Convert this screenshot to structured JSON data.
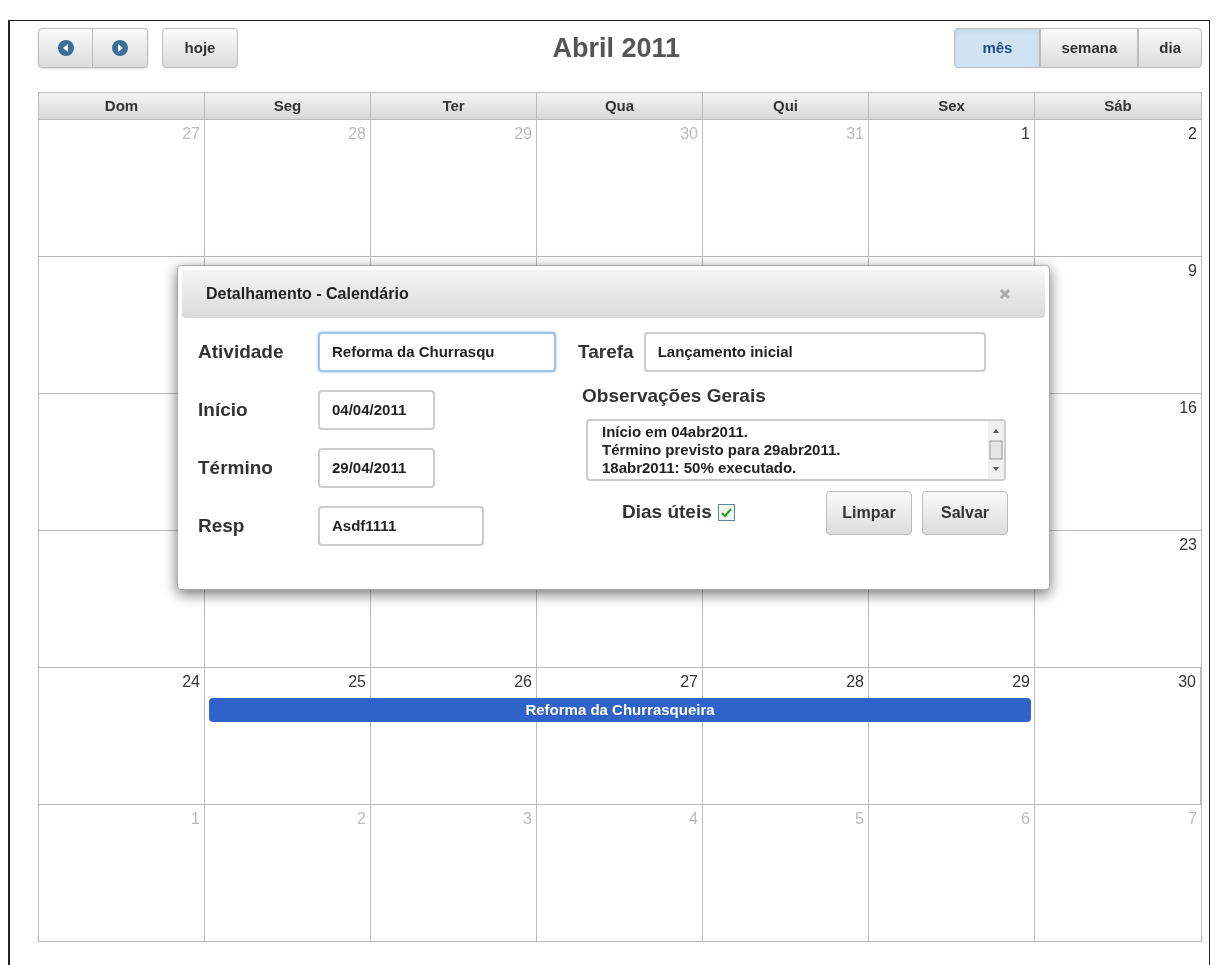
{
  "toolbar": {
    "today": "hoje",
    "title": "Abril 2011",
    "views": [
      {
        "label": "mês",
        "selected": true
      },
      {
        "label": "semana",
        "selected": false
      },
      {
        "label": "dia",
        "selected": false
      }
    ]
  },
  "weekdays": [
    "Dom",
    "Seg",
    "Ter",
    "Qua",
    "Qui",
    "Sex",
    "Sáb"
  ],
  "weeks": [
    {
      "kind": "full",
      "days": [
        {
          "label": "27",
          "other_month": true
        },
        {
          "label": "28",
          "other_month": true
        },
        {
          "label": "29",
          "other_month": true
        },
        {
          "label": "30",
          "other_month": true
        },
        {
          "label": "31",
          "other_month": true
        },
        {
          "label": "1",
          "other_month": false
        },
        {
          "label": "2",
          "other_month": false
        }
      ]
    },
    {
      "kind": "last_only",
      "days": [
        {
          "label": "9",
          "other_month": false
        }
      ]
    },
    {
      "kind": "last_only",
      "days": [
        {
          "label": "16",
          "other_month": false
        }
      ]
    },
    {
      "kind": "last_only",
      "days": [
        {
          "label": "23",
          "other_month": false
        }
      ]
    },
    {
      "kind": "full",
      "event": {
        "title": "Reforma da Churrasqueira"
      },
      "days": [
        {
          "label": "24",
          "other_month": false,
          "in_event": false
        },
        {
          "label": "25",
          "other_month": false,
          "in_event": true
        },
        {
          "label": "26",
          "other_month": false,
          "in_event": true
        },
        {
          "label": "27",
          "other_month": false,
          "in_event": true
        },
        {
          "label": "28",
          "other_month": false,
          "in_event": true
        },
        {
          "label": "29",
          "other_month": false,
          "in_event": true
        },
        {
          "label": "30",
          "other_month": false,
          "in_event": false
        }
      ]
    },
    {
      "kind": "full",
      "days": [
        {
          "label": "1",
          "other_month": true
        },
        {
          "label": "2",
          "other_month": true
        },
        {
          "label": "3",
          "other_month": true
        },
        {
          "label": "4",
          "other_month": true
        },
        {
          "label": "5",
          "other_month": true
        },
        {
          "label": "6",
          "other_month": true
        },
        {
          "label": "7",
          "other_month": true
        }
      ]
    }
  ],
  "dialog": {
    "title": "Detalhamento - Calendário",
    "left_fields": [
      {
        "label": "Atividade",
        "value": "Reforma da Churrasqu",
        "focused": true
      },
      {
        "label": "Início",
        "value": "04/04/2011",
        "focused": false
      },
      {
        "label": "Término",
        "value": "29/04/2011",
        "focused": false
      },
      {
        "label": "Resp",
        "value": "Asdf1111",
        "focused": false
      }
    ],
    "task": {
      "label": "Tarefa",
      "value": "Lançamento inicial"
    },
    "notes": {
      "label": "Observações Gerais",
      "lines": [
        "Início em 04abr2011.",
        "Término previsto para 29abr2011.",
        "18abr2011: 50% executado."
      ]
    },
    "workdays": {
      "label": "Dias úteis",
      "checked": true
    },
    "buttons": [
      "Limpar",
      "Salvar"
    ]
  }
}
